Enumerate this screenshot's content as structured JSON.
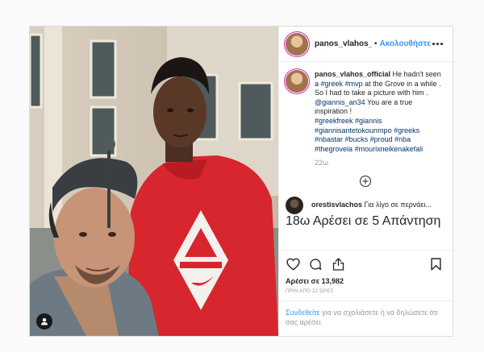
{
  "post": {
    "username": "panos_vlahos_offici",
    "follow_label": "Ακολουθήστε",
    "separator": "•"
  },
  "caption": {
    "username": "panos_vlahos_official",
    "text_1": "He hadn't seen a",
    "hashtag_greek": "#greek",
    "hashtag_mvp": "#mvp",
    "text_2": "at the Grove in a while . So I had to take a picture with him .",
    "mention": "@giannis_an34",
    "text_3": "You are a true inspiration !",
    "hashtags": [
      "#greekfreek",
      "#giannis",
      "#giannisantetokounmpo",
      "#greeks",
      "#nbastar",
      "#bucks",
      "#proud",
      "#nba",
      "#thegrovela",
      "#mourixneikenakefali"
    ],
    "age": "22ω"
  },
  "comment": {
    "username": "orestisvlachos",
    "text": "Για λίγο σε περνάει...",
    "age": "18ω",
    "likes": "Αρέσει σε 5",
    "reply": "Απάντηση"
  },
  "stats": {
    "likes": "Αρέσει σε 13,982",
    "date": "ΠΡΙΝ ΑΠΌ 22 ΏΡΕΣ"
  },
  "add_comment": {
    "login_link": "Συνδεθείτε",
    "text": "για να σχολιάσετε ή να δηλώσετε ότι σας αρέσει."
  }
}
